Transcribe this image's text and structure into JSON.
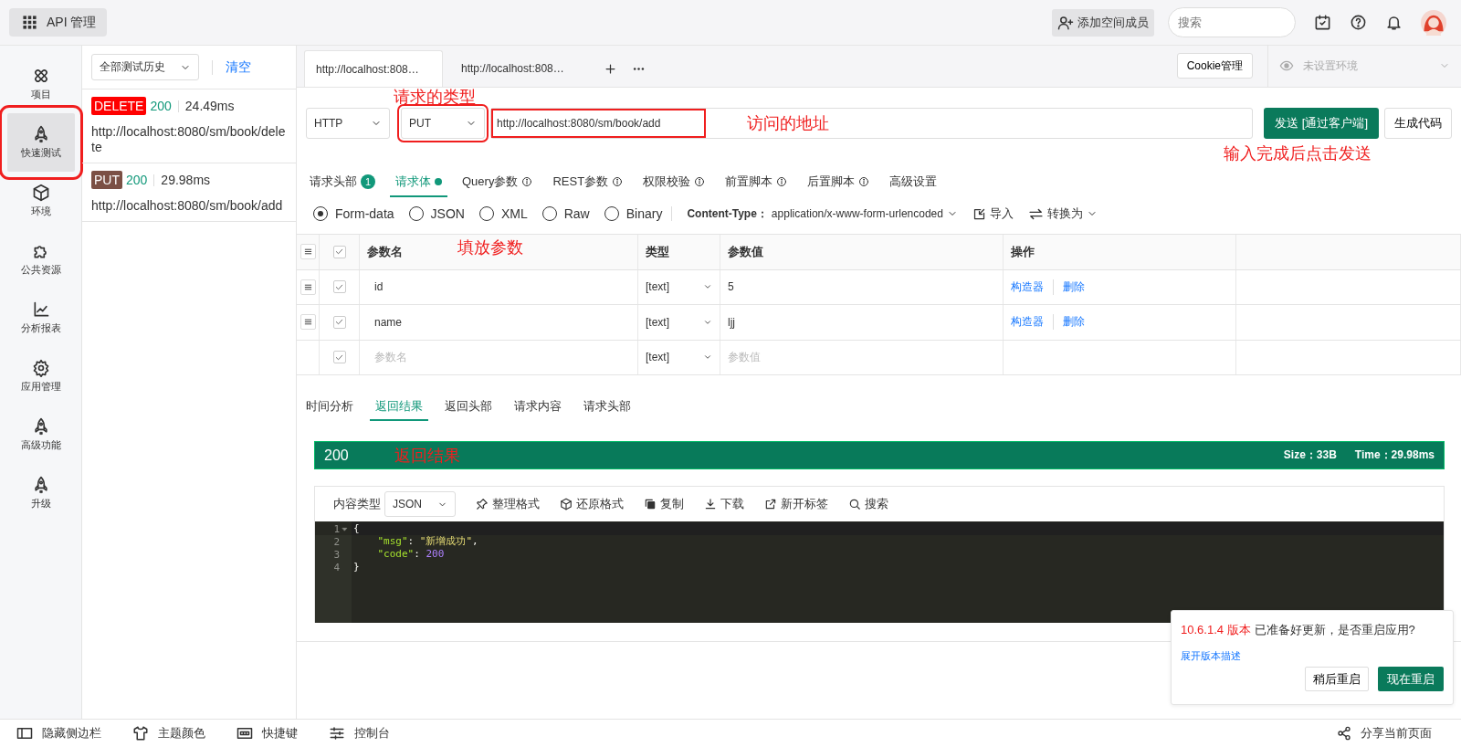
{
  "app_button": {
    "label": "API 管理"
  },
  "header": {
    "invite_button": "添加空间成员",
    "search": {
      "placeholder": "搜索"
    }
  },
  "nav": [
    {
      "label": "项目",
      "selected": false,
      "outlined": false
    },
    {
      "label": "快速测试",
      "selected": true,
      "outlined": true
    },
    {
      "label": "环境",
      "selected": false,
      "outlined": false
    },
    {
      "label": "公共资源",
      "selected": false,
      "outlined": false
    },
    {
      "label": "分析报表",
      "selected": false,
      "outlined": false
    },
    {
      "label": "应用管理",
      "selected": false,
      "outlined": false
    },
    {
      "label": "高级功能",
      "selected": false,
      "outlined": false
    },
    {
      "label": "升级",
      "selected": false,
      "outlined": false
    }
  ],
  "history": {
    "filter": "全部测试历史",
    "clear": "清空",
    "items": [
      {
        "method": "DELETE",
        "color": "#ff0000",
        "status": "200",
        "time": "24.49ms",
        "url": "http://localhost:8080/sm/book/delete"
      },
      {
        "method": "PUT",
        "color": "#7b5045",
        "status": "200",
        "time": "29.98ms",
        "url": "http://localhost:8080/sm/book/add"
      }
    ]
  },
  "request_tabs": [
    {
      "label": "http://localhost:808…",
      "selected": true
    },
    {
      "label": "http://localhost:808…",
      "selected": false
    }
  ],
  "cookie_button": "Cookie管理",
  "environment": {
    "placeholder": "未设置环境"
  },
  "request": {
    "protocol": "HTTP",
    "method": {
      "value": "PUT",
      "outlined": true,
      "note": "请求的类型"
    },
    "url": {
      "value": "http://localhost:8080/sm/book/add",
      "outlined": true,
      "note": "访问的地址"
    },
    "send_button": "发送 [通过客户端]",
    "send_note": "输入完成后点击发送",
    "code_button": "生成代码"
  },
  "section_tabs": [
    {
      "label": "请求头部",
      "badge": "1",
      "selected": false
    },
    {
      "label": "请求体",
      "dot": true,
      "selected": true
    },
    {
      "label": "Query参数",
      "info": true,
      "selected": false
    },
    {
      "label": "REST参数",
      "info": true,
      "selected": false
    },
    {
      "label": "权限校验",
      "info": true,
      "selected": false
    },
    {
      "label": "前置脚本",
      "info": true,
      "selected": false
    },
    {
      "label": "后置脚本",
      "info": true,
      "selected": false
    },
    {
      "label": "高级设置",
      "selected": false
    }
  ],
  "body_types": [
    {
      "label": "Form-data",
      "selected": true
    },
    {
      "label": "JSON",
      "selected": false
    },
    {
      "label": "XML",
      "selected": false
    },
    {
      "label": "Raw",
      "selected": false
    },
    {
      "label": "Binary",
      "selected": false
    }
  ],
  "content_type": {
    "label": "Content-Type：",
    "value": "application/x-www-form-urlencoded"
  },
  "import_button": "导入",
  "convert_button": "转换为",
  "params": {
    "all_checked": true,
    "columns": [
      "参数名",
      "类型",
      "参数值",
      "操作"
    ],
    "note": "填放参数",
    "rows": [
      {
        "kind": "param",
        "checked": true,
        "name": "id",
        "type": "[text]",
        "value": "5",
        "actions": [
          "构造器",
          "删除"
        ]
      },
      {
        "kind": "param",
        "checked": true,
        "name": "name",
        "type": "[text]",
        "value": "ljj",
        "actions": [
          "构造器",
          "删除"
        ]
      },
      {
        "kind": "new",
        "checked": true,
        "name_placeholder": "参数名",
        "type": "[text]",
        "value_placeholder": "参数值"
      }
    ]
  },
  "response_tabs": [
    {
      "label": "时间分析",
      "selected": false
    },
    {
      "label": "返回结果",
      "selected": true
    },
    {
      "label": "返回头部",
      "selected": false
    },
    {
      "label": "请求内容",
      "selected": false
    },
    {
      "label": "请求头部",
      "selected": false
    }
  ],
  "response": {
    "status": "200",
    "note": "返回结果",
    "size": "Size：33B",
    "time": "Time：29.98ms",
    "content_type_label": "内容类型",
    "format": "JSON",
    "tools": [
      "整理格式",
      "还原格式",
      "复制",
      "下载",
      "新开标签",
      "搜索"
    ],
    "code": [
      {
        "number": "1",
        "foldable": true,
        "tokens": [
          {
            "kind": "punct",
            "text": "{"
          }
        ]
      },
      {
        "number": "2",
        "foldable": false,
        "tokens": [
          {
            "kind": "key",
            "text": "    \"msg\""
          },
          {
            "kind": "punct",
            "text": ": "
          },
          {
            "kind": "string",
            "text": "\"新增成功\""
          },
          {
            "kind": "punct",
            "text": ","
          }
        ]
      },
      {
        "number": "3",
        "foldable": false,
        "tokens": [
          {
            "kind": "key",
            "text": "    \"code\""
          },
          {
            "kind": "punct",
            "text": ": "
          },
          {
            "kind": "number",
            "text": "200"
          }
        ]
      },
      {
        "number": "4",
        "foldable": false,
        "tokens": [
          {
            "kind": "punct",
            "text": "}"
          }
        ]
      }
    ]
  },
  "update_notice": {
    "version": "10.6.1.4 版本",
    "message": "已准备好更新，是否重启应用?",
    "link": "展开版本描述",
    "later": "稍后重启",
    "now": "现在重启"
  },
  "footer": {
    "items": [
      "隐藏侧边栏",
      "主题颜色",
      "快捷键",
      "控制台"
    ],
    "share": "分享当前页面"
  }
}
